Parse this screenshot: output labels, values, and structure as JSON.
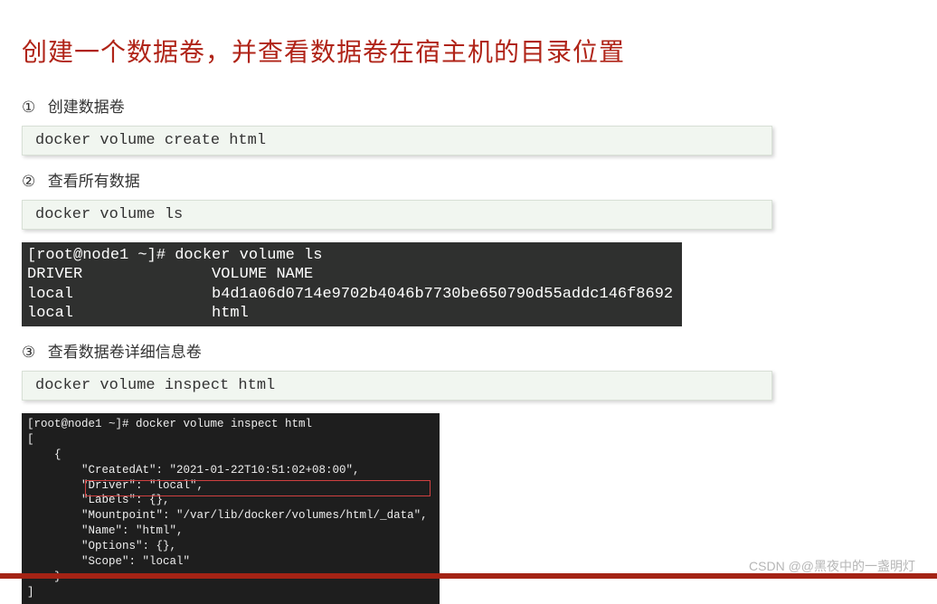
{
  "title": "创建一个数据卷，并查看数据卷在宿主机的目录位置",
  "steps": {
    "s1": {
      "num": "①",
      "label": "创建数据卷",
      "cmd": "docker volume create html"
    },
    "s2": {
      "num": "②",
      "label": "查看所有数据",
      "cmd": "docker volume ls"
    },
    "s3": {
      "num": "③",
      "label": "查看数据卷详细信息卷",
      "cmd": "docker volume inspect html"
    }
  },
  "terminal1": "[root@node1 ~]# docker volume ls\nDRIVER              VOLUME NAME\nlocal               b4d1a06d0714e9702b4046b7730be650790d55addc146f8692\nlocal               html",
  "terminal2": "[root@node1 ~]# docker volume inspect html\n[\n    {\n        \"CreatedAt\": \"2021-01-22T10:51:02+08:00\",\n        \"Driver\": \"local\",\n        \"Labels\": {},\n        \"Mountpoint\": \"/var/lib/docker/volumes/html/_data\",\n        \"Name\": \"html\",\n        \"Options\": {},\n        \"Scope\": \"local\"\n    }\n]",
  "watermark": "CSDN @@黑夜中的一盏明灯"
}
